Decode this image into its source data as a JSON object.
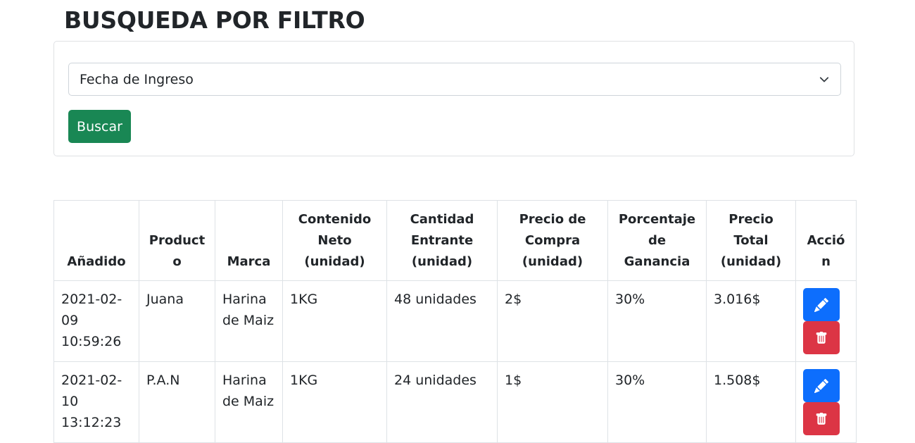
{
  "page": {
    "title": "BUSQUEDA POR FILTRO"
  },
  "filter": {
    "selected_option": "Fecha de Ingreso",
    "search_label": "Buscar"
  },
  "table": {
    "headers": [
      "Añadido",
      "Producto",
      "Marca",
      "Contenido Neto (unidad)",
      "Cantidad Entrante (unidad)",
      "Precio de Compra (unidad)",
      "Porcentaje de Ganancia",
      "Precio Total (unidad)",
      "Acción"
    ],
    "rows": [
      {
        "added": "2021-02-09 10:59:26",
        "product": "Juana",
        "brand": "Harina de Maiz",
        "net_content": "1KG",
        "incoming_quantity": "48 unidades",
        "purchase_price": "2$",
        "profit_percentage": "30%",
        "total_price": "3.016$"
      },
      {
        "added": "2021-02-10 13:12:23",
        "product": "P.A.N",
        "brand": "Harina de Maiz",
        "net_content": "1KG",
        "incoming_quantity": "24 unidades",
        "purchase_price": "1$",
        "profit_percentage": "30%",
        "total_price": "1.508$"
      }
    ]
  },
  "icons": {
    "edit": "pencil-icon",
    "delete": "trash-icon",
    "select_arrow": "chevron-down-icon"
  },
  "colors": {
    "search_button": "#198754",
    "edit_button": "#0d6efd",
    "delete_button": "#dc3545"
  }
}
